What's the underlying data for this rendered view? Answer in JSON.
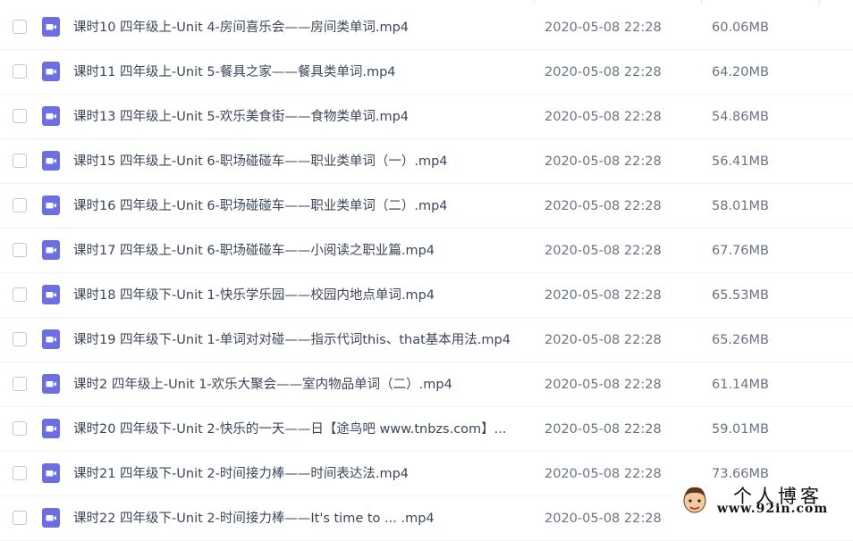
{
  "files": [
    {
      "name": "课时10 四年级上-Unit 4-房间喜乐会——房间类单词.mp4",
      "date": "2020-05-08 22:28",
      "size": "60.06MB",
      "icon": "video-file-icon"
    },
    {
      "name": "课时11 四年级上-Unit 5-餐具之家——餐具类单词.mp4",
      "date": "2020-05-08 22:28",
      "size": "64.20MB",
      "icon": "video-file-icon"
    },
    {
      "name": "课时13 四年级上-Unit 5-欢乐美食街——食物类单词.mp4",
      "date": "2020-05-08 22:28",
      "size": "54.86MB",
      "icon": "video-file-icon"
    },
    {
      "name": "课时15 四年级上-Unit 6-职场碰碰车——职业类单词（一）.mp4",
      "date": "2020-05-08 22:28",
      "size": "56.41MB",
      "icon": "video-file-icon"
    },
    {
      "name": "课时16 四年级上-Unit 6-职场碰碰车——职业类单词（二）.mp4",
      "date": "2020-05-08 22:28",
      "size": "58.01MB",
      "icon": "video-file-icon"
    },
    {
      "name": "课时17 四年级上-Unit 6-职场碰碰车——小阅读之职业篇.mp4",
      "date": "2020-05-08 22:28",
      "size": "67.76MB",
      "icon": "video-file-icon"
    },
    {
      "name": "课时18 四年级下-Unit 1-快乐学乐园——校园内地点单词.mp4",
      "date": "2020-05-08 22:28",
      "size": "65.53MB",
      "icon": "video-file-icon"
    },
    {
      "name": "课时19 四年级下-Unit 1-单词对对碰——指示代词this、that基本用法.mp4",
      "date": "2020-05-08 22:28",
      "size": "65.26MB",
      "icon": "video-file-icon"
    },
    {
      "name": "课时2 四年级上-Unit 1-欢乐大聚会——室内物品单词（二）.mp4",
      "date": "2020-05-08 22:28",
      "size": "61.14MB",
      "icon": "video-file-icon"
    },
    {
      "name": "课时20 四年级下-Unit 2-快乐的一天——日【途鸟吧 www.tnbzs.com】...",
      "date": "2020-05-08 22:28",
      "size": "59.01MB",
      "icon": "video-file-icon"
    },
    {
      "name": "课时21 四年级下-Unit 2-时间接力棒——时间表达法.mp4",
      "date": "2020-05-08 22:28",
      "size": "73.66MB",
      "icon": "video-file-icon"
    },
    {
      "name": "课时22 四年级下-Unit 2-时间接力棒——It's time to ... .mp4",
      "date": "2020-05-08 22:28",
      "size": "",
      "icon": "video-file-icon"
    }
  ],
  "watermark": {
    "title": "个人博客",
    "url": "www.92in.com"
  },
  "colors": {
    "icon_purple": "#6b6fe3",
    "text": "#3c4658",
    "muted": "#6a7282",
    "divider": "#f2f3f6"
  }
}
